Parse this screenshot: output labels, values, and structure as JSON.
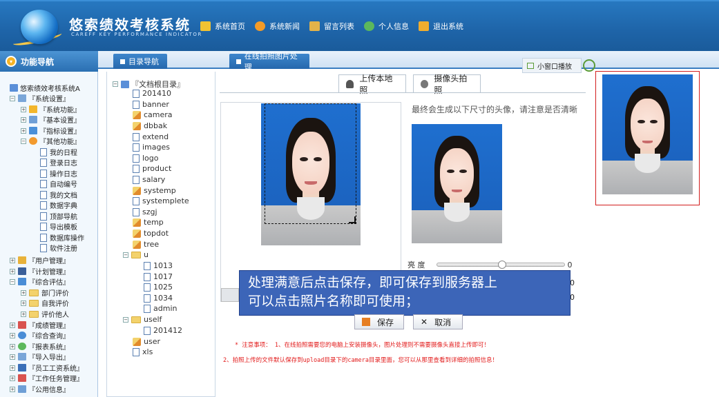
{
  "header": {
    "title": "悠索绩效考核系统",
    "subtitle": "CAREFF KEY PERFORMANCE INDICATOR",
    "nav": [
      {
        "label": "系统首页",
        "icon": "home-icon"
      },
      {
        "label": "系统新闻",
        "icon": "news-icon"
      },
      {
        "label": "留言列表",
        "icon": "message-icon"
      },
      {
        "label": "个人信息",
        "icon": "user-icon"
      },
      {
        "label": "退出系统",
        "icon": "exit-icon"
      }
    ]
  },
  "sidebar": {
    "title": "功能导航",
    "items": [
      "悠索绩效考核系统A",
      "『系统设置』",
      "『系统功能』",
      "『基本设置』",
      "『指标设置』",
      "『其他功能』",
      "我的日程",
      "登录日志",
      "操作日志",
      "自动编号",
      "我的文档",
      "数据字典",
      "顶部导航",
      "导出模板",
      "数据库操作",
      "软件注册",
      "『用户管理』",
      "『计划管理』",
      "『综合评估』",
      "部门评价",
      "自我评价",
      "评价他人",
      "『成绩管理』",
      "『综合查询』",
      "『报表系统』",
      "『导入导出』",
      "『员工工资系统』",
      "『工作任务管理』",
      "『公用信息』"
    ]
  },
  "tabs": {
    "tab1": "目录导航",
    "tab2": "在线拍照图片处理",
    "small_window": "小窗口播放"
  },
  "dirtree": {
    "root": "『文档根目录』",
    "items": [
      "201410",
      "banner",
      "camera",
      "dbbak",
      "extend",
      "images",
      "logo",
      "product",
      "salary",
      "systemp",
      "systemplete",
      "szgj",
      "temp",
      "topdot",
      "tree",
      "u",
      "1013",
      "1017",
      "1025",
      "1034",
      "admin",
      "uself",
      "201412",
      "user",
      "xls"
    ]
  },
  "upload": {
    "tab_local": "上传本地照",
    "tab_camera": "摄像头拍照",
    "hint": "最终会生成以下尺寸的头像，请注意是否清晰",
    "brightness_label": "亮 度",
    "brightness_value": "0",
    "slider2_value": "0",
    "slider3_value": "0",
    "save": "保存",
    "cancel": "取消",
    "tooltip_line1": "处理满意后点击保存，即可保存到服务器上",
    "tooltip_line2": "可以点击照片名称即可使用；",
    "note1": "* 注意事项： 1、在线拍照需要您的电脑上安装摄像头，图片处理则不需要摄像头直接上传即可！",
    "note2": "2、拍照上传的文件默认保存到upload目录下的camera目录里面，您可以从那里查看到详细的拍照信息！"
  },
  "colors": {
    "header": "#1e64a8",
    "accent": "#3a7dc1",
    "note": "#e21b1b",
    "tooltip": "#3c65b8"
  }
}
